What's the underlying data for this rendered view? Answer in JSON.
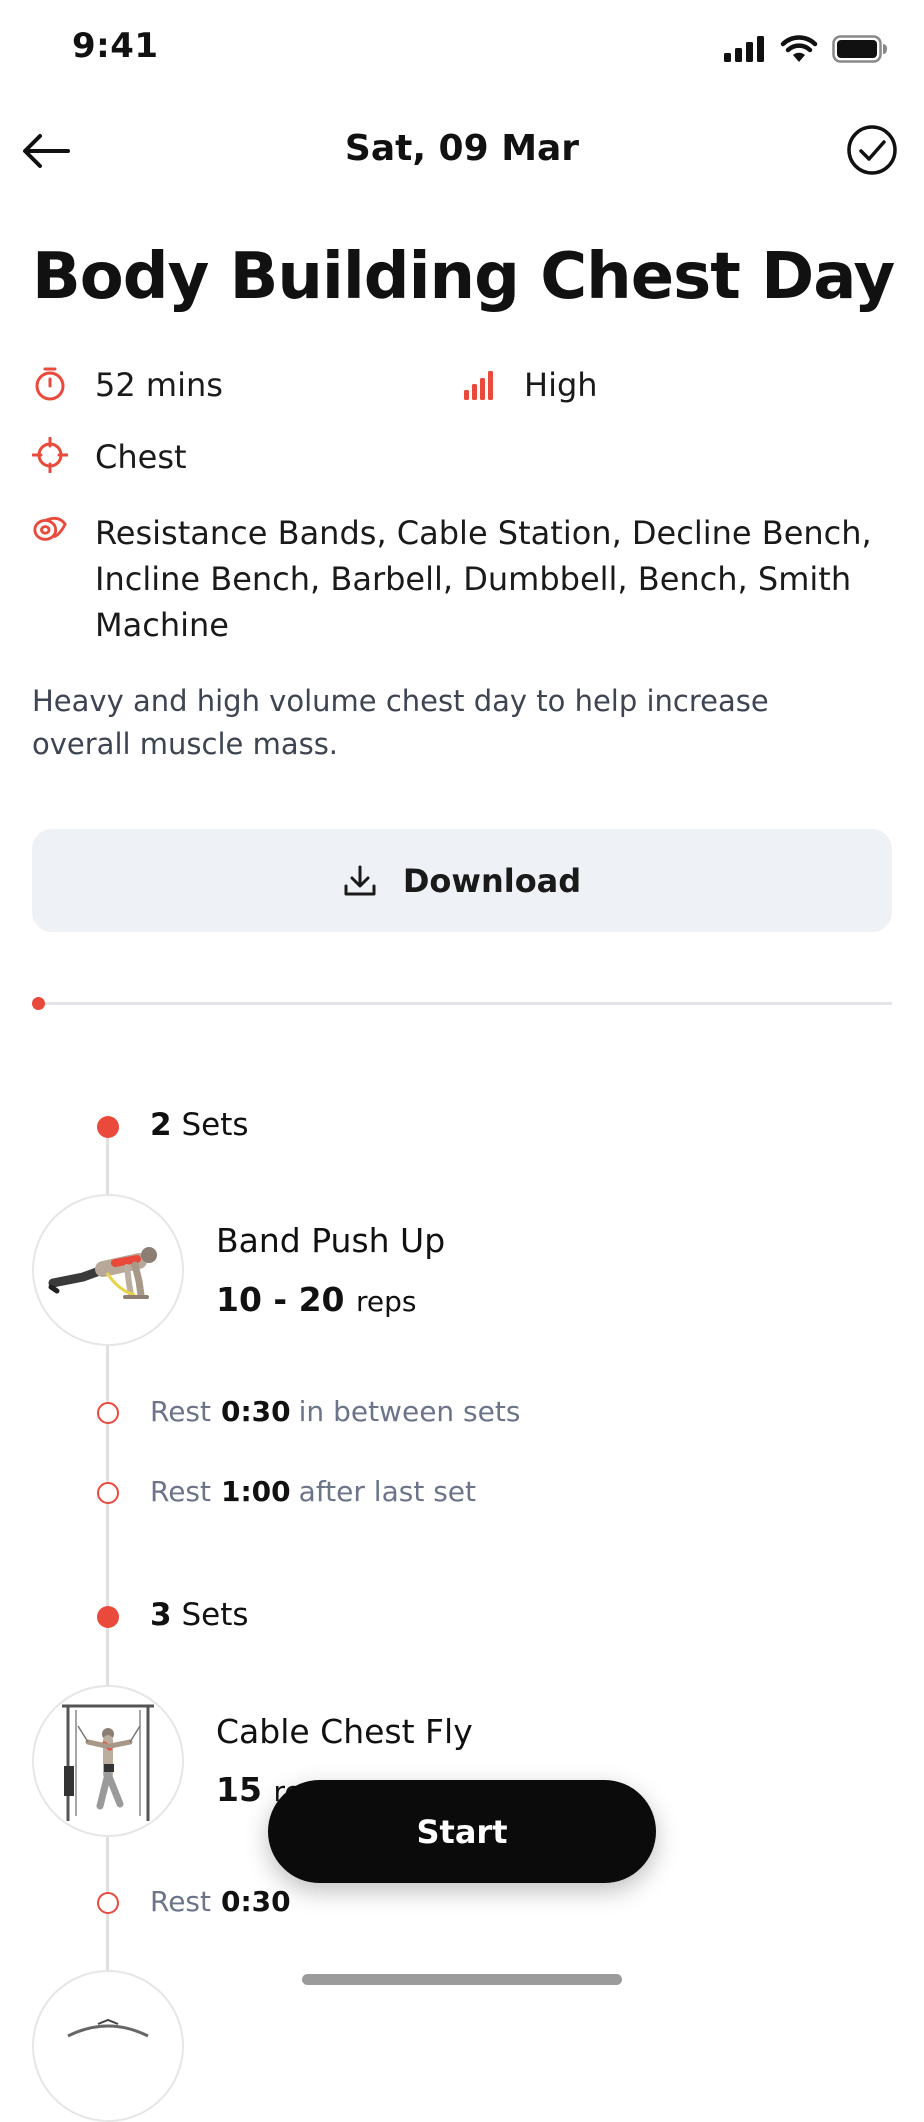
{
  "status_bar": {
    "time": "9:41"
  },
  "header": {
    "date": "Sat, 09 Mar"
  },
  "workout": {
    "title": "Body Building Chest Day",
    "duration": "52 mins",
    "intensity": "High",
    "muscle": "Chest",
    "equipment_line1": "Resistance Bands, Cable Station, Decline Bench,",
    "equipment_line2": "Incline Bench, Barbell, Dumbbell, Bench, Smith",
    "equipment_line3": "Machine",
    "description": "Heavy and high volume chest day to help increase overall muscle mass.",
    "progress": 0
  },
  "download": {
    "label": "Download"
  },
  "exercises": [
    {
      "sets_count": "2",
      "sets_label": "Sets",
      "name": "Band Push Up",
      "reps": "10 - 20",
      "reps_unit": "reps",
      "rests": [
        {
          "label": "Rest",
          "value": "0:30",
          "suffix": "in between sets"
        },
        {
          "label": "Rest",
          "value": "1:00",
          "suffix": "after last set"
        }
      ]
    },
    {
      "sets_count": "3",
      "sets_label": "Sets",
      "name": "Cable Chest Fly",
      "reps": "15",
      "reps_unit": "re",
      "rests": [
        {
          "label": "Rest",
          "value": "0:30"
        }
      ]
    }
  ],
  "start": {
    "label": "Start"
  },
  "colors": {
    "accent": "#ea4a3c",
    "button_bg": "#0b0b0b",
    "download_bg": "#eef1f5"
  }
}
